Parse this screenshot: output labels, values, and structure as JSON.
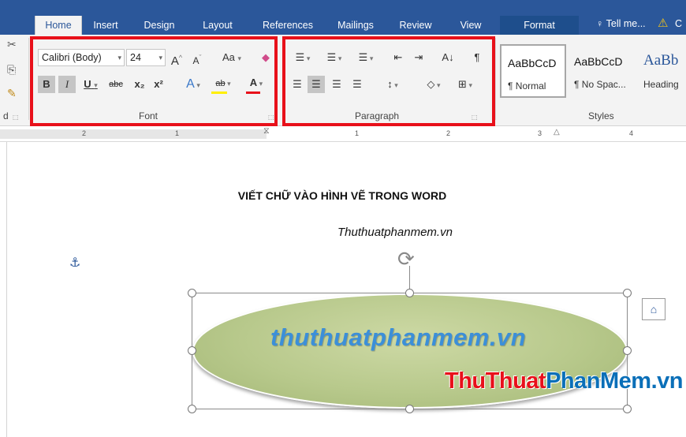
{
  "tabs": [
    {
      "label": "Home"
    },
    {
      "label": "Insert"
    },
    {
      "label": "Design"
    },
    {
      "label": "Layout"
    },
    {
      "label": "References"
    },
    {
      "label": "Mailings"
    },
    {
      "label": "Review"
    },
    {
      "label": "View"
    },
    {
      "label": "Format"
    }
  ],
  "tell_me": "♀ Tell me...",
  "warning_text": "C",
  "font": {
    "family": "Calibri (Body)",
    "size": "24",
    "group_label": "Font",
    "grow": "A",
    "shrink": "A",
    "change_case": "Aa",
    "bold": "B",
    "italic": "I",
    "underline": "U",
    "strike": "abc",
    "subscript": "x₂",
    "superscript": "x²",
    "effects": "A",
    "highlight": "ab",
    "font_color": "A"
  },
  "paragraph": {
    "group_label": "Paragraph",
    "show_marks": "¶",
    "sort": "A↓"
  },
  "clipboard": {
    "label_fragment": "d"
  },
  "styles": {
    "group_label": "Styles",
    "items": [
      {
        "preview": "AaBbCcD",
        "name": "¶ Normal"
      },
      {
        "preview": "AaBbCcD",
        "name": "¶ No Spac..."
      },
      {
        "preview": "AaBb",
        "name": "Heading"
      }
    ]
  },
  "ruler": {
    "numbers": [
      "2",
      "1",
      "1",
      "2",
      "3",
      "4"
    ]
  },
  "document": {
    "title": "VIẾT CHỮ VÀO HÌNH VẼ TRONG WORD",
    "subtitle": "Thuthuatphanmem.vn",
    "shape_text": "thuthuatphanmem.vn"
  },
  "watermark": {
    "part1": "ThuThuat",
    "part2": "PhanMem",
    "part3": ".vn"
  },
  "colors": {
    "ribbon_blue": "#2b579a",
    "highlight_red": "#e8101a",
    "shape_fill": "#b8c98c",
    "shape_text": "#3c8fd8"
  }
}
